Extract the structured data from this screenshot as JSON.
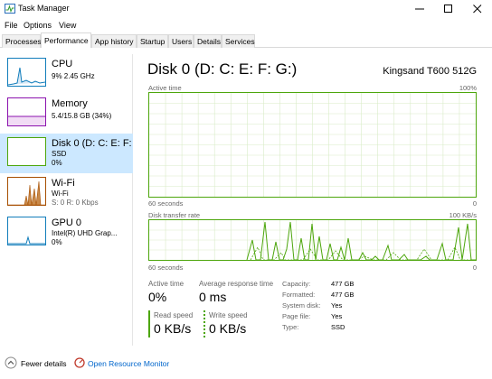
{
  "window": {
    "title": "Task Manager"
  },
  "menu": [
    "File",
    "Options",
    "View"
  ],
  "tabs": [
    "Processes",
    "Performance",
    "App history",
    "Startup",
    "Users",
    "Details",
    "Services"
  ],
  "sidebar": [
    {
      "name": "CPU",
      "sub1": "9% 2.45 GHz",
      "color": "#117dbb"
    },
    {
      "name": "Memory",
      "sub1": "5.4/15.8 GB (34%)",
      "color": "#8b12ae"
    },
    {
      "name": "Disk 0 (D: C: E: F: G:)",
      "sub1": "SSD",
      "sub2": "0%",
      "color": "#4da60c"
    },
    {
      "name": "Wi-Fi",
      "sub1": "Wi-Fi",
      "sub2": "S: 0 R: 0 Kbps",
      "color": "#a74f01"
    },
    {
      "name": "GPU 0",
      "sub1": "Intel(R) UHD Grap...",
      "sub2": "0%",
      "color": "#117dbb"
    }
  ],
  "main": {
    "title": "Disk 0 (D: C: E: F: G:)",
    "model": "Kingsand T600 512G",
    "graph1": {
      "label": "Active time",
      "max": "100%",
      "left": "60 seconds",
      "right": "0"
    },
    "graph2": {
      "label": "Disk transfer rate",
      "max": "100 KB/s",
      "left": "60 seconds",
      "right": "0"
    },
    "stats": {
      "active_time_label": "Active time",
      "active_time_value": "0%",
      "avg_resp_label": "Average response time",
      "avg_resp_value": "0 ms",
      "read_label": "Read speed",
      "read_value": "0 KB/s",
      "write_label": "Write speed",
      "write_value": "0 KB/s"
    },
    "properties": [
      {
        "label": "Capacity:",
        "value": "477 GB"
      },
      {
        "label": "Formatted:",
        "value": "477 GB"
      },
      {
        "label": "System disk:",
        "value": "Yes"
      },
      {
        "label": "Page file:",
        "value": "Yes"
      },
      {
        "label": "Type:",
        "value": "SSD"
      }
    ]
  },
  "footer": {
    "fewer_details": "Fewer details",
    "open_resource_monitor": "Open Resource Monitor"
  },
  "colors": {
    "disk": "#4da60c",
    "cpu": "#117dbb",
    "memory": "#8b12ae",
    "wifi": "#a74f01",
    "link": "#0066cc"
  }
}
